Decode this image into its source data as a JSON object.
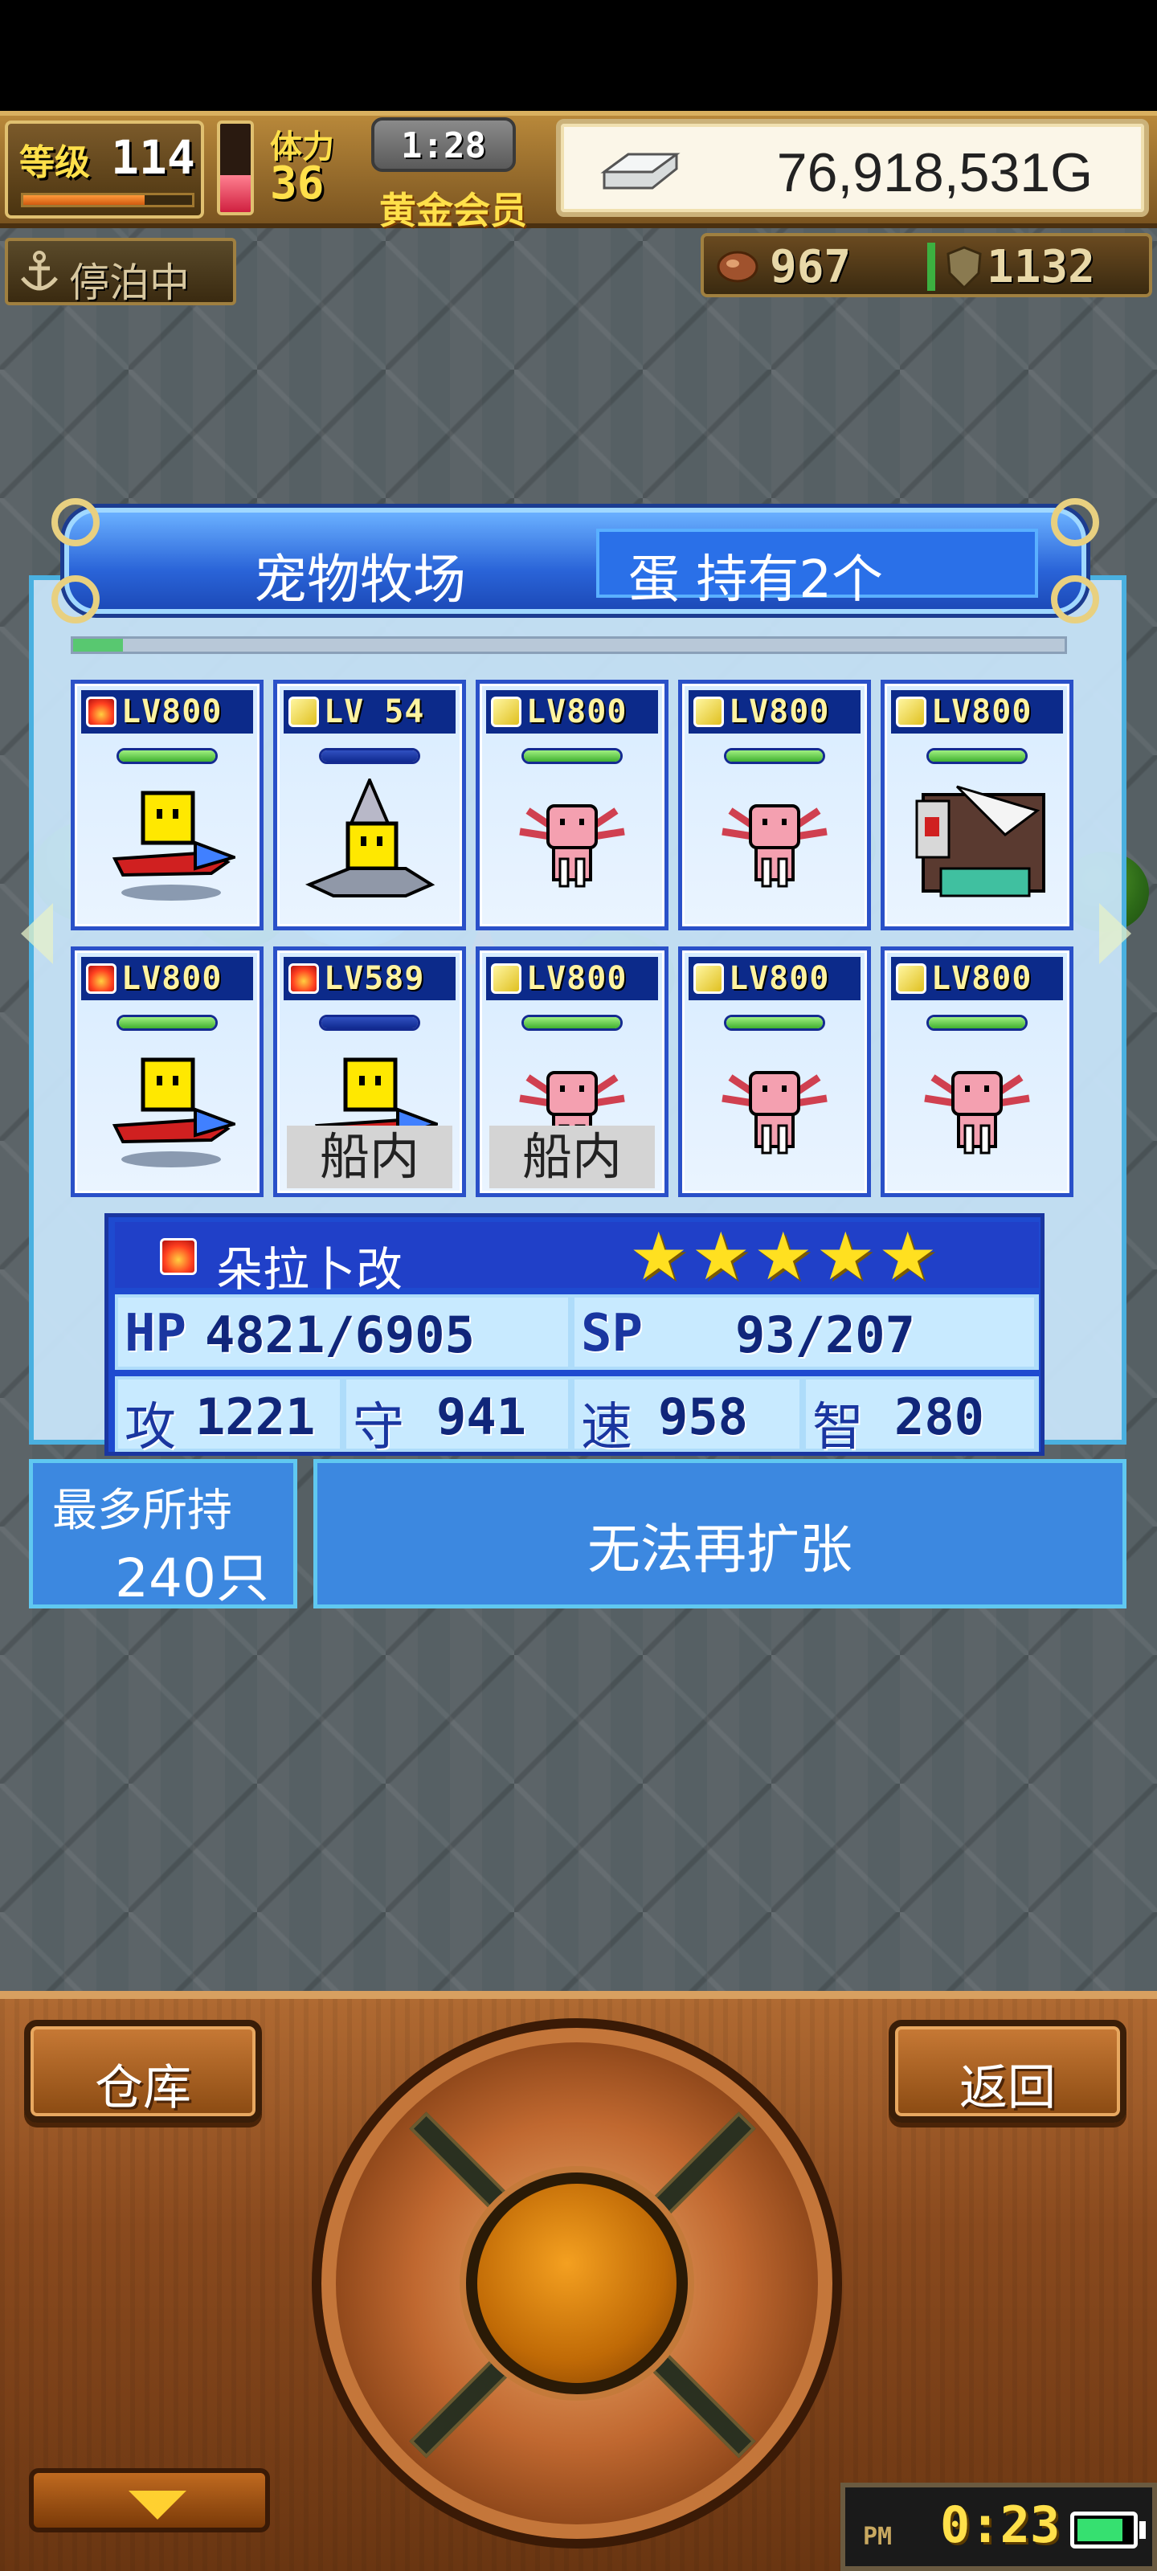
{
  "hud": {
    "level_label": "等级",
    "level_value": "114",
    "exp_fraction": 0.72,
    "stamina_fraction": 0.42,
    "stamina_label": "体力",
    "stamina_value": "36",
    "clock": "1:28",
    "membership": "黄金会员",
    "gold": "76,918,531G",
    "dock_status": "停泊中",
    "food": "967",
    "material": "1132"
  },
  "ranch": {
    "title": "宠物牧场",
    "egg_status": "蛋 持有2个",
    "progress_fraction": 0.05,
    "pets_row1": [
      {
        "element": "fire-icon",
        "level": "LV800",
        "hp_fraction": 1.0,
        "hp_style": "green",
        "sprite": "kairobot-rocket",
        "onboard": ""
      },
      {
        "element": "thunder-icon",
        "level": "LV 54",
        "hp_fraction": 1.0,
        "hp_style": "blue",
        "sprite": "kairobot-drill",
        "onboard": ""
      },
      {
        "element": "thunder-icon",
        "level": "LV800",
        "hp_fraction": 1.0,
        "hp_style": "green",
        "sprite": "axolotl",
        "onboard": ""
      },
      {
        "element": "thunder-icon",
        "level": "LV800",
        "hp_fraction": 1.0,
        "hp_style": "green",
        "sprite": "axolotl",
        "onboard": ""
      },
      {
        "element": "thunder-icon",
        "level": "LV800",
        "hp_fraction": 1.0,
        "hp_style": "green",
        "sprite": "mecha-beast",
        "onboard": ""
      }
    ],
    "pets_row2": [
      {
        "element": "fire-icon",
        "level": "LV800",
        "hp_fraction": 1.0,
        "hp_style": "green",
        "sprite": "kairobot-rocket",
        "onboard": ""
      },
      {
        "element": "fire-icon",
        "level": "LV589",
        "hp_fraction": 1.0,
        "hp_style": "blue",
        "sprite": "kairobot-rocket",
        "onboard": "船内"
      },
      {
        "element": "thunder-icon",
        "level": "LV800",
        "hp_fraction": 1.0,
        "hp_style": "green",
        "sprite": "axolotl",
        "onboard": "船内"
      },
      {
        "element": "thunder-icon",
        "level": "LV800",
        "hp_fraction": 1.0,
        "hp_style": "green",
        "sprite": "axolotl",
        "onboard": ""
      },
      {
        "element": "thunder-icon",
        "level": "LV800",
        "hp_fraction": 1.0,
        "hp_style": "green",
        "sprite": "axolotl",
        "onboard": ""
      }
    ]
  },
  "stats": {
    "element": "fire-icon",
    "pet_name": "朵拉卜改",
    "stars": "★★★★★",
    "star_count": 5,
    "hp_label": "HP",
    "hp_value": "4821/6905",
    "sp_label": "SP",
    "sp_value": "93/207",
    "atk_label": "攻",
    "atk_value": "1221",
    "def_label": "守",
    "def_value": "941",
    "spd_label": "速",
    "spd_value": "958",
    "int_label": "智",
    "int_value": "280"
  },
  "capacity": {
    "label": "最多所持",
    "value": "240只"
  },
  "expand_label": "无法再扩张",
  "controls": {
    "storage_label": "仓库",
    "back_label": "返回"
  },
  "status_bar": {
    "ampm": "PM",
    "time": "0:23",
    "battery_fraction": 0.85
  },
  "colors": {
    "panel_blue": "#2a64d8",
    "gold_text": "#ffe04a",
    "wood": "#8a4a1e"
  }
}
